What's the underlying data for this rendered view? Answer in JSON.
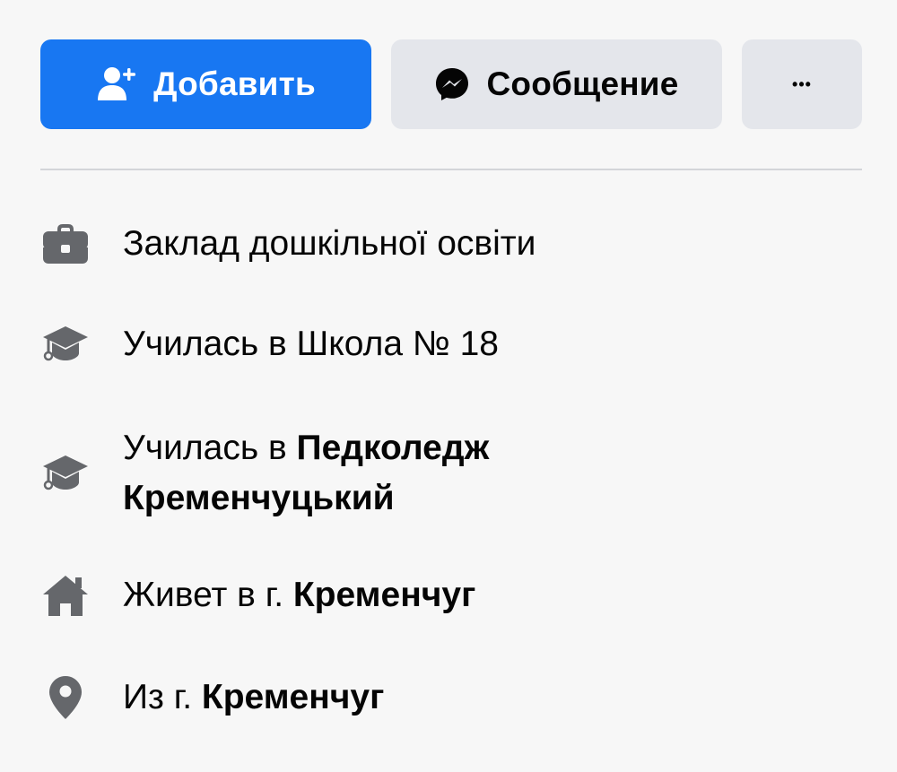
{
  "actions": {
    "add_label": "Добавить",
    "message_label": "Сообщение",
    "more_label": "•••"
  },
  "colors": {
    "primary": "#1877f2",
    "secondary_button": "#e4e6eb",
    "icon_gray": "#65676b",
    "text": "#050505"
  },
  "info": {
    "work": {
      "icon": "briefcase-icon",
      "text": "Заклад дошкільної освіти"
    },
    "school": {
      "icon": "graduation-cap-icon",
      "prefix": "Училась в Школа № 18"
    },
    "college": {
      "icon": "graduation-cap-icon",
      "prefix": "Училась в ",
      "name": "Педколедж Кременчуцький"
    },
    "lives": {
      "icon": "home-icon",
      "prefix": "Живет в г. ",
      "place": "Кременчуг"
    },
    "from": {
      "icon": "location-pin-icon",
      "prefix": "Из г. ",
      "place": "Кременчуг"
    }
  }
}
